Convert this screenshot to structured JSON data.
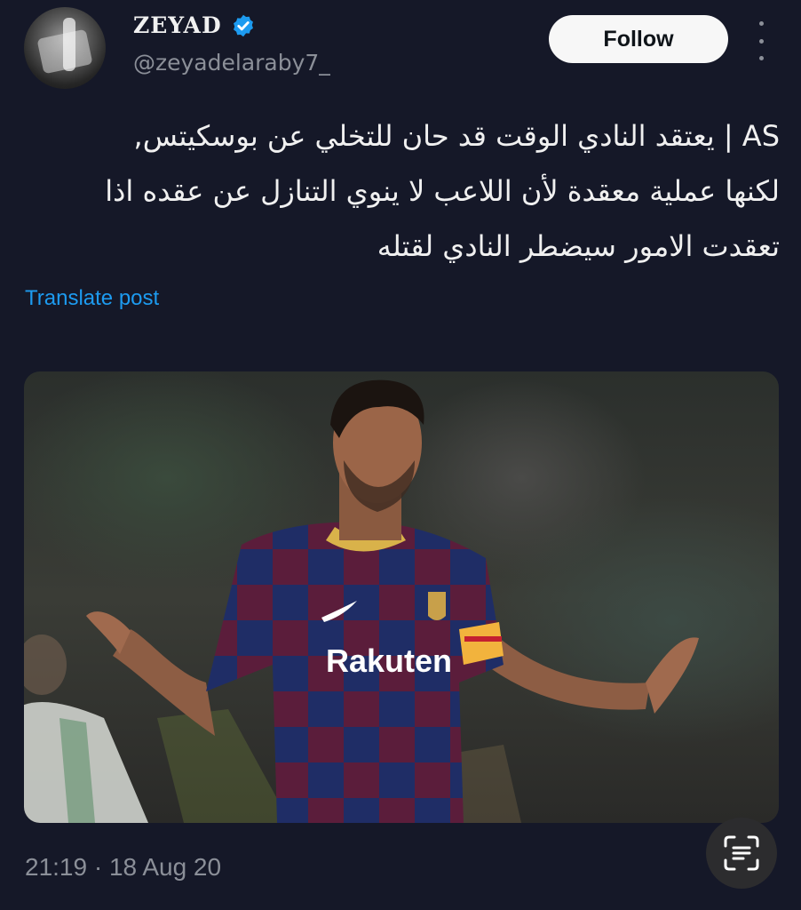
{
  "author": {
    "name": "ZEYAD",
    "handle": "@zeyadelaraby7_",
    "verified_icon": "verified-badge-icon"
  },
  "actions": {
    "follow_label": "Follow",
    "more_icon": "more-vertical-icon"
  },
  "tweet": {
    "text": "AS | يعتقد النادي الوقت قد حان للتخلي عن بوسكيتس,\nلكنها عملية معقدة لأن اللاعب لا ينوي التنازل عن عقده اذا\nتعقدت الامور سيضطر النادي لقتله",
    "translate_label": "Translate post"
  },
  "media": {
    "jersey_sponsor": "Rakuten"
  },
  "meta": {
    "timestamp": "21:19 · 18 Aug 20"
  },
  "overlay": {
    "scan_icon": "text-scan-icon"
  },
  "colors": {
    "background": "#151828",
    "link": "#1d9bf0",
    "verified": "#1d9bf0"
  }
}
